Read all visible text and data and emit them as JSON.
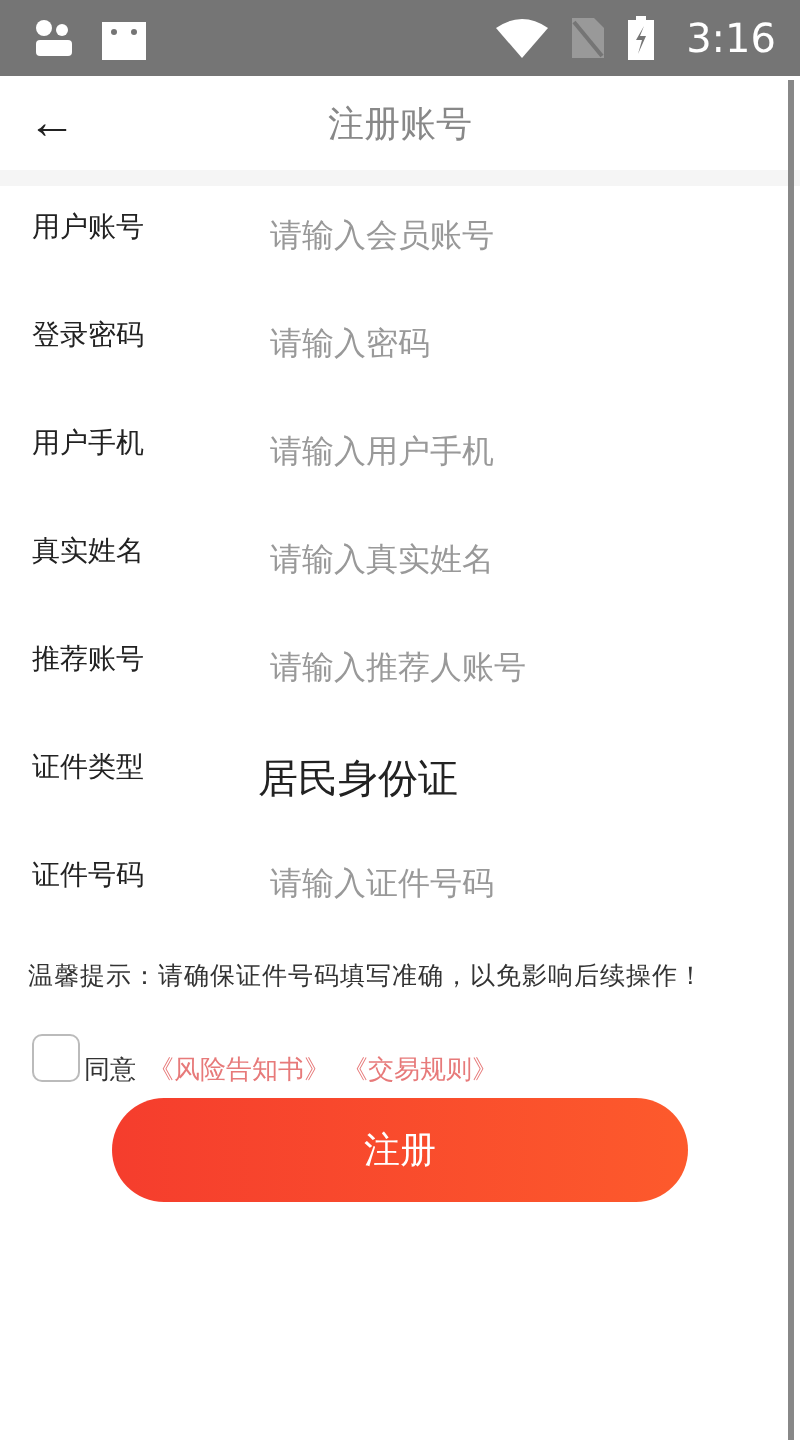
{
  "status_bar": {
    "time": "3:16"
  },
  "header": {
    "back": "←",
    "title": "注册账号"
  },
  "fields": [
    {
      "kind": "input",
      "label": "用户账号",
      "placeholder": "请输入会员账号"
    },
    {
      "kind": "input",
      "label": "登录密码",
      "placeholder": "请输入密码"
    },
    {
      "kind": "input",
      "label": "用户手机",
      "placeholder": "请输入用户手机"
    },
    {
      "kind": "input",
      "label": "真实姓名",
      "placeholder": "请输入真实姓名"
    },
    {
      "kind": "input",
      "label": "推荐账号",
      "placeholder": "请输入推荐人账号"
    },
    {
      "kind": "value",
      "label": "证件类型",
      "value": "居民身份证"
    },
    {
      "kind": "input",
      "label": "证件号码",
      "placeholder": "请输入证件号码"
    }
  ],
  "tip": "温馨提示：请确保证件号码填写准确，以免影响后续操作！",
  "agreement": {
    "checked": false,
    "label": "同意",
    "links": [
      "《风险告知书》",
      "《交易规则》"
    ]
  },
  "submit": "注册"
}
